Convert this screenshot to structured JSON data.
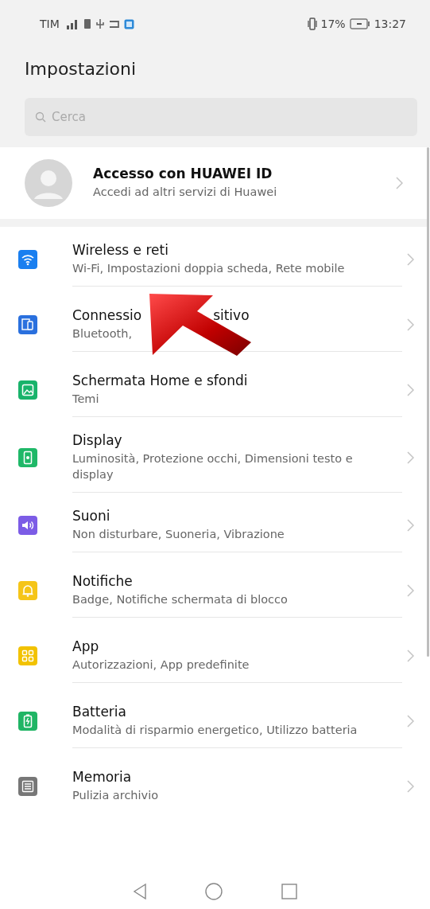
{
  "status_bar": {
    "carrier": "TIM",
    "battery_percent": "17%",
    "time": "13:27"
  },
  "header": {
    "title": "Impostazioni"
  },
  "search": {
    "placeholder": "Cerca"
  },
  "account": {
    "title": "Accesso con HUAWEI ID",
    "subtitle": "Accedi ad altri servizi di Huawei"
  },
  "items": [
    {
      "kind": "wifi",
      "color": "#1a7ff0",
      "title": "Wireless e reti",
      "subtitle": "Wi-Fi, Impostazioni doppia scheda, Rete mobile"
    },
    {
      "kind": "devices",
      "color": "#2a70de",
      "title": "Connessio",
      "title_end": "sitivo",
      "subtitle": "Bluetooth,"
    },
    {
      "kind": "image",
      "color": "#19b36b",
      "title": "Schermata Home e sfondi",
      "subtitle": "Temi"
    },
    {
      "kind": "display",
      "color": "#1fb868",
      "title": "Display",
      "subtitle": "Luminosità, Protezione occhi, Dimensioni testo e display"
    },
    {
      "kind": "sound",
      "color": "#7c5ce6",
      "title": "Suoni",
      "subtitle": "Non disturbare, Suoneria, Vibrazione"
    },
    {
      "kind": "bell",
      "color": "#f5c518",
      "title": "Notifiche",
      "subtitle": "Badge, Notifiche schermata di blocco"
    },
    {
      "kind": "grid",
      "color": "#f2c200",
      "title": "App",
      "subtitle": "Autorizzazioni, App predefinite"
    },
    {
      "kind": "battery",
      "color": "#20b565",
      "title": "Batteria",
      "subtitle": "Modalità di risparmio energetico, Utilizzo batteria"
    },
    {
      "kind": "storage",
      "color": "#777777",
      "title": "Memoria",
      "subtitle": "Pulizia archivio"
    }
  ]
}
